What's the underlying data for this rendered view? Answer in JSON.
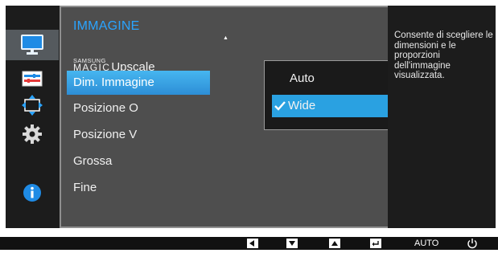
{
  "menu": {
    "title": "IMMAGINE",
    "items": [
      {
        "brand": "SAMSUNG",
        "magic": "MAGIC",
        "label": "Upscale"
      },
      {
        "label": "Dim. Immagine"
      },
      {
        "label": "Posizione O"
      },
      {
        "label": "Posizione V"
      },
      {
        "label": "Grossa"
      },
      {
        "label": "Fine"
      }
    ],
    "selected_index": 1
  },
  "submenu": {
    "options": [
      "Auto",
      "Wide"
    ],
    "selected": "Wide"
  },
  "description": "Consente di scegliere le dimensioni e le proporzioni dell'immagine visualizzata.",
  "left_icons": [
    "monitor-icon",
    "color-adjust-icon",
    "size-position-icon",
    "settings-gear-icon",
    "info-icon"
  ],
  "bottom_bar": {
    "buttons": [
      "left-arrow-icon",
      "down-arrow-icon",
      "up-arrow-icon",
      "enter-icon",
      "auto-button",
      "power-icon"
    ],
    "auto_label": "AUTO"
  },
  "colors": {
    "accent_blue": "#2aa4ff",
    "selection_blue": "#2aa1e1",
    "panel_gray": "#4e4e4e",
    "background_dark": "#1c1c1c"
  }
}
